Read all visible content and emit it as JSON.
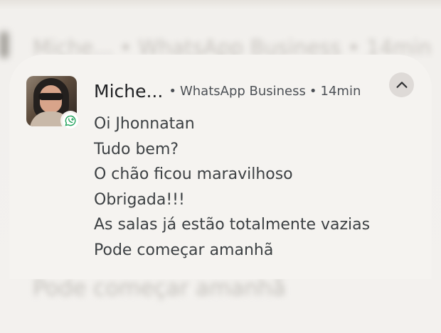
{
  "background": {
    "top_text": "Miche... • WhatsApp Business • 14min",
    "bottom_text": "Pode começar amanhã"
  },
  "notification": {
    "sender": "Miche...",
    "app": "WhatsApp Business",
    "time": "14min",
    "separator": "•",
    "avatar": "profile-photo-woman-with-sunglasses",
    "badge_icon": "whatsapp-business-icon",
    "expand_icon": "chevron-up-icon",
    "messages": [
      "Oi Jhonnatan",
      "Tudo bem?",
      "O chão ficou maravilhoso",
      "Obrigada!!!",
      "As salas já estão totalmente vazias",
      "Pode começar amanhã"
    ]
  },
  "colors": {
    "card": "#f5f3f0",
    "whatsapp": "#1fa25a",
    "text": "#3c4043",
    "sender": "#202124"
  }
}
